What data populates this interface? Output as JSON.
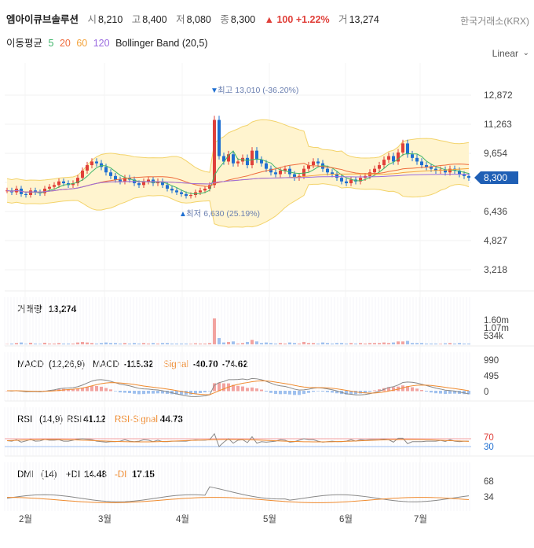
{
  "header": {
    "name": "엠아이큐브솔루션",
    "open_label": "시",
    "open": "8,210",
    "high_label": "고",
    "high": "8,400",
    "low_label": "저",
    "low": "8,080",
    "close_label": "종",
    "close": "8,300",
    "change": "▲ 100",
    "change_pct": "+1.22%",
    "volume_label": "거",
    "volume": "13,274",
    "exchange": "한국거래소(KRX)"
  },
  "indicator_bar": {
    "ma_label": "이동평균",
    "ma5": "5",
    "ma20": "20",
    "ma60": "60",
    "ma120": "120",
    "bollinger": "Bollinger Band (20,5)",
    "scale": "Linear"
  },
  "colors": {
    "up": "#e0403a",
    "down": "#1f6fd1",
    "ma5": "#3fb56a",
    "ma20": "#ef6b3d",
    "ma60": "#f3a33b",
    "ma120": "#9b6be0",
    "band_fill": "#fff4cf",
    "band_line": "#f3d36a",
    "current_tag": "#1f5fb5"
  },
  "chart_data": [
    {
      "type": "candlestick",
      "title": "price",
      "y_ticks": [
        "12,872",
        "11,263",
        "9,654",
        "8,045",
        "6,436",
        "4,827",
        "3,218"
      ],
      "ylim": [
        3218,
        12872
      ],
      "current_price_label": "8,300",
      "annotations": {
        "max": "최고 13,010 (-36.20%)",
        "min": "최저 6,630 (25.19%)"
      },
      "x_ticks": [
        "2월",
        "3월",
        "4월",
        "5월",
        "6월",
        "7월"
      ],
      "note": "approx. daily closes Jan–Jul",
      "closes": [
        7600,
        7500,
        7700,
        7400,
        7350,
        7600,
        7500,
        7450,
        7700,
        7800,
        7900,
        8100,
        8000,
        7900,
        8000,
        8300,
        8700,
        9000,
        9200,
        9100,
        8900,
        8600,
        8400,
        8200,
        8100,
        8300,
        8200,
        8000,
        7900,
        8100,
        8200,
        8000,
        8100,
        7900,
        7700,
        7600,
        7500,
        7400,
        7300,
        7350,
        7500,
        7600,
        7700,
        7900,
        11500,
        9500,
        9200,
        9600,
        9100,
        9200,
        9400,
        9000,
        9800,
        9300,
        9100,
        8800,
        8600,
        8500,
        8700,
        8800,
        8500,
        8300,
        8400,
        8800,
        9000,
        9200,
        9100,
        8800,
        8600,
        8500,
        8300,
        8100,
        8000,
        8200,
        8100,
        8300,
        8400,
        8600,
        8800,
        9000,
        9300,
        9500,
        9200,
        9700,
        10200,
        9600,
        9400,
        9200,
        9000,
        8900,
        8800,
        8700,
        8750,
        8600,
        8800,
        8700,
        8500,
        8400,
        8300
      ]
    },
    {
      "type": "bar",
      "title": "거래량",
      "value": "13,274",
      "y_ticks": [
        "1.60m",
        "1.07m",
        "534k"
      ]
    },
    {
      "type": "line",
      "title": "MACD",
      "params": "(12,26,9)",
      "macd_label": "MACD",
      "macd": "-115.32",
      "signal_label": "Signal",
      "signal": "-40.70",
      "hist": "-74.62",
      "y_ticks": [
        "990",
        "495",
        "0"
      ]
    },
    {
      "type": "line",
      "title": "RSI",
      "params": "(14,9)",
      "rsi_label": "RSI",
      "rsi": "41.12",
      "signal_label": "RSI-Signal",
      "signal": "44.73",
      "y_ticks": [
        "70",
        "30"
      ]
    },
    {
      "type": "line",
      "title": "DMI",
      "params": "(14)",
      "pdi_label": "+DI",
      "pdi": "14.48",
      "mdi_label": "-DI",
      "mdi": "17.15",
      "y_ticks": [
        "68",
        "34"
      ]
    }
  ]
}
